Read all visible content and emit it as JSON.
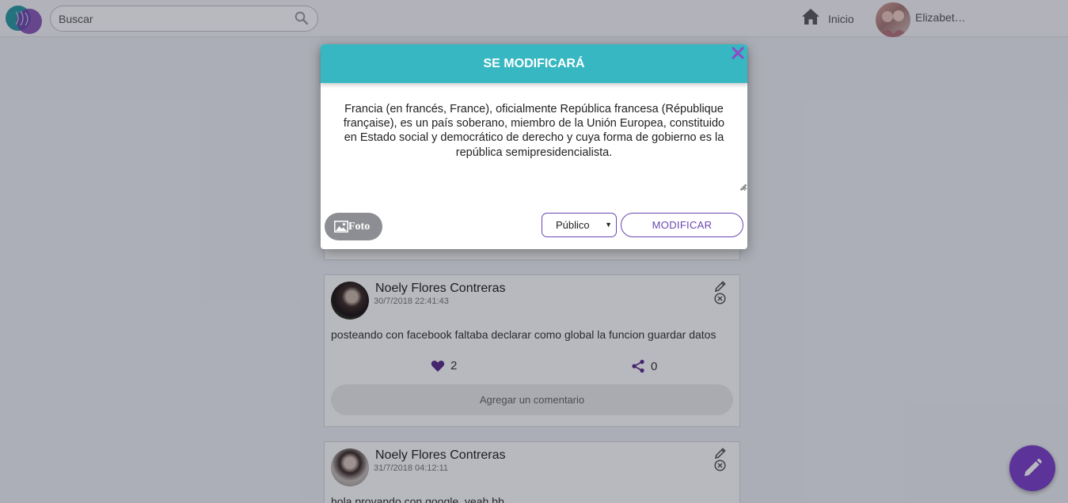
{
  "navbar": {
    "search_placeholder": "Buscar",
    "home_label": "Inicio",
    "user_name": "Elizabet…"
  },
  "feed": {
    "posts": [
      {
        "author": "Noely Flores Contreras",
        "date": "30/7/2018 22:41:43",
        "text": "posteando con facebook faltaba declarar como global la funcion guardar datos",
        "likes": "2",
        "shares": "0",
        "comment_label": "Agregar un comentario"
      },
      {
        "author": "Noely Flores Contreras",
        "date": "31/7/2018 04:12:11",
        "text": "hola provando con google, yeah bb"
      }
    ]
  },
  "modal": {
    "title": "SE MODIFICARÁ",
    "text": "Francia (en francés, France), oficialmente República francesa (République française), es un país soberano, miembro de la Unión Europea, constituido en Estado social y democrático de derecho y cuya forma de gobierno es la república semipresidencialista.",
    "photo_label": "Foto",
    "privacy_value": "Público",
    "submit_label": "MODIFICAR"
  },
  "colors": {
    "modal_header": "#37b7c1",
    "accent": "#6a45b2",
    "fab": "#7b3fc9",
    "close_icon": "#8a4fc6"
  },
  "icons": [
    "logo",
    "search-icon",
    "home-icon",
    "pencil-icon",
    "delete-icon",
    "heart-icon",
    "share-icon",
    "close-icon",
    "image-icon"
  ]
}
